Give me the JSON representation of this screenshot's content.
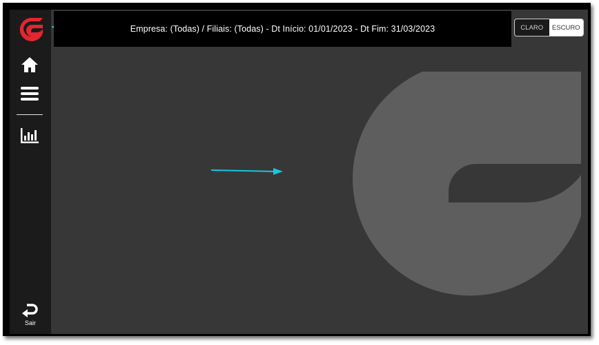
{
  "header": {
    "filter_summary": "Empresa: (Todas) / Filiais: (Todas) - Dt Início: 01/01/2023 - Dt Fim: 31/03/2023"
  },
  "theme_toggle": {
    "light_label": "CLARO",
    "dark_label": "ESCURO",
    "selected": "ESCURO"
  },
  "sidebar": {
    "items": [
      {
        "icon": "home-icon"
      },
      {
        "icon": "menu-icon"
      },
      {
        "icon": "bar-chart-icon"
      }
    ],
    "exit_label": "Sair"
  },
  "colors": {
    "brand_red": "#e4262f",
    "sidebar_bg": "#1b1b1b",
    "content_bg": "#373737",
    "watermark": "#5e5e5e",
    "annotation_arrow": "#16c7e0"
  }
}
